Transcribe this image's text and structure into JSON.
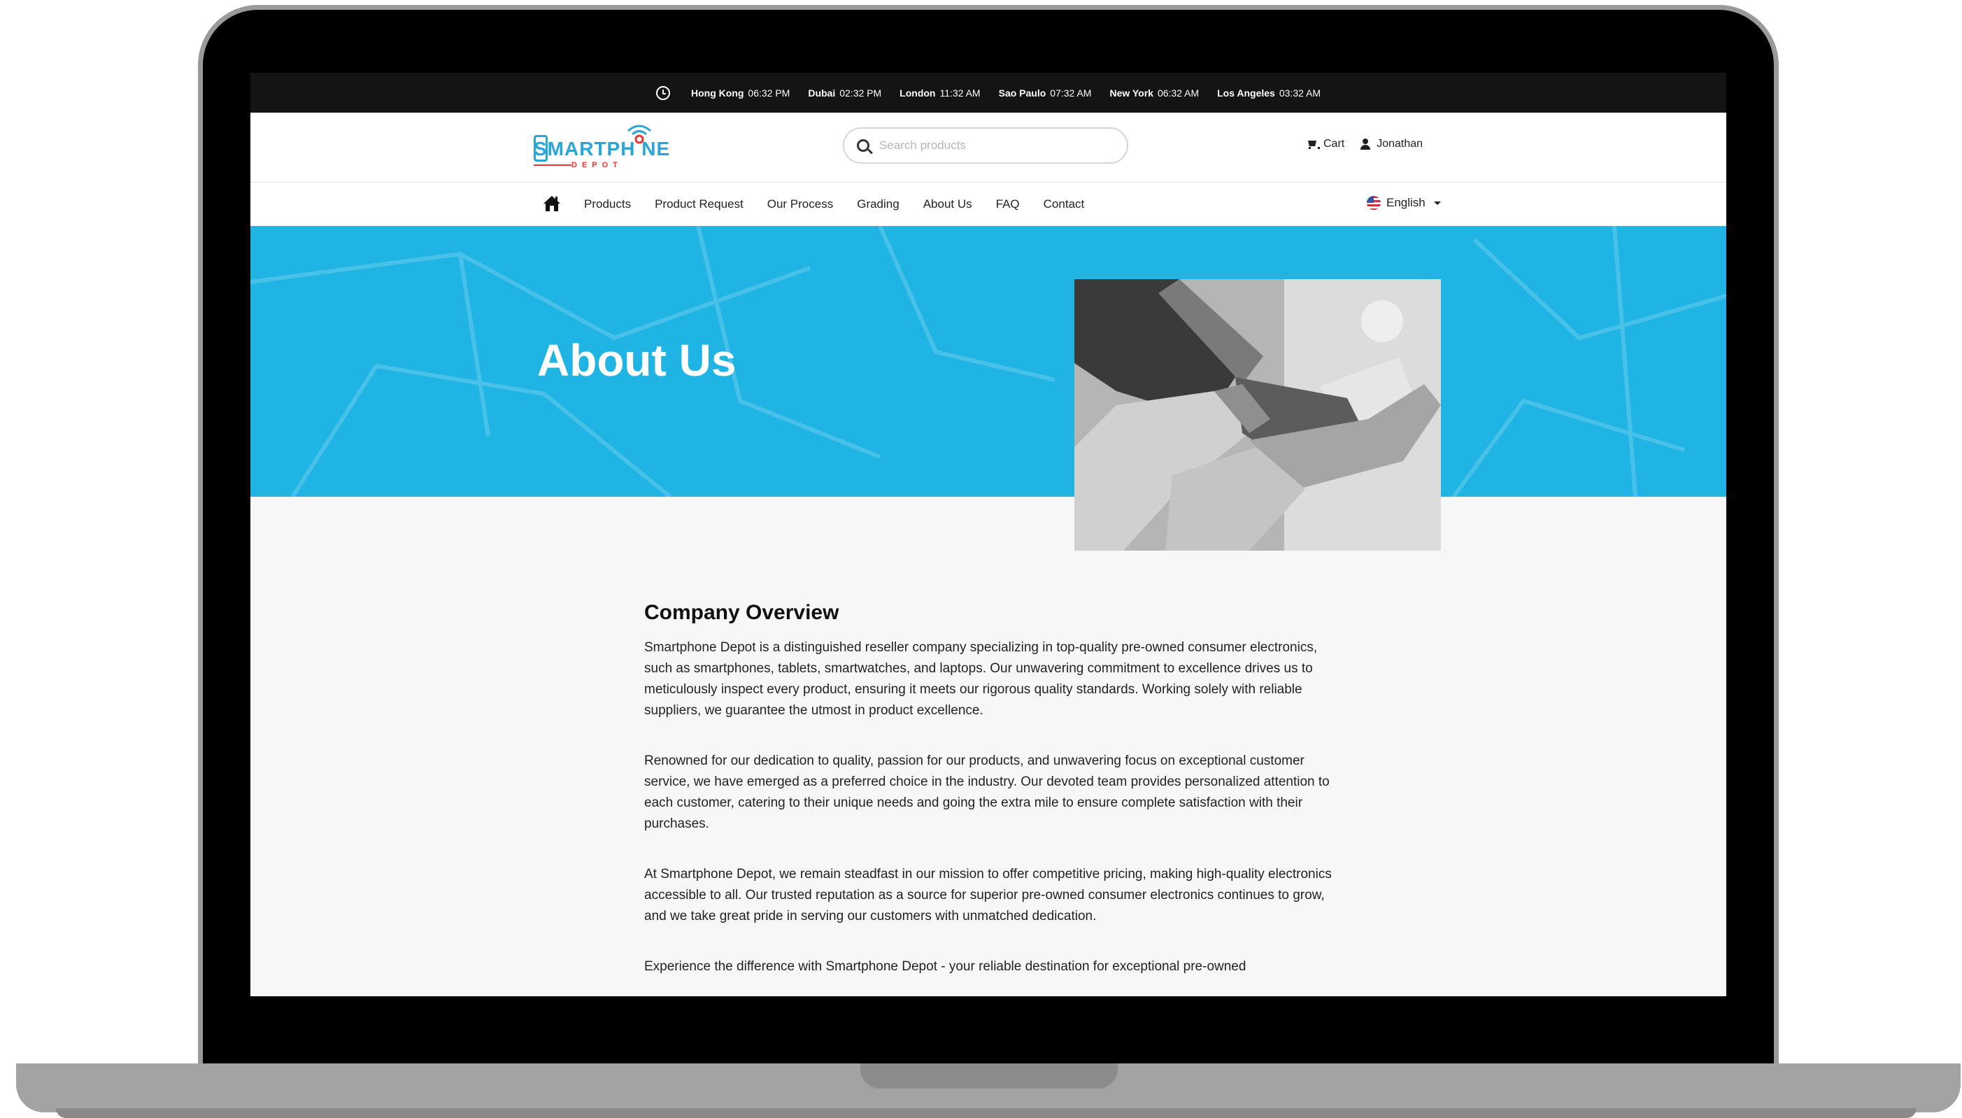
{
  "clocks": [
    {
      "city": "Hong Kong",
      "time": "06:32 PM"
    },
    {
      "city": "Dubai",
      "time": "02:32 PM"
    },
    {
      "city": "London",
      "time": "11:32 AM"
    },
    {
      "city": "Sao Paulo",
      "time": "07:32 AM"
    },
    {
      "city": "New York",
      "time": "06:32 AM"
    },
    {
      "city": "Los Angeles",
      "time": "03:32 AM"
    }
  ],
  "header": {
    "logo_text": "SMARTPH NE",
    "logo_sub": "DEPOT",
    "search_placeholder": "Search products",
    "cart_label": "Cart",
    "user_label": "Jonathan"
  },
  "nav": {
    "links": [
      "Products",
      "Product Request",
      "Our Process",
      "Grading",
      "About Us",
      "FAQ",
      "Contact"
    ],
    "language": "English"
  },
  "hero": {
    "title": "About Us"
  },
  "content": {
    "heading": "Company Overview",
    "paragraphs": [
      "Smartphone Depot is a distinguished reseller company specializing in top-quality pre-owned consumer electronics, such as smartphones, tablets, smartwatches, and laptops. Our unwavering commitment to excellence drives us to meticulously inspect every product, ensuring it meets our rigorous quality standards. Working solely with reliable suppliers, we guarantee the utmost in product excellence.",
      "Renowned for our dedication to quality, passion for our products, and unwavering focus on exceptional customer service, we have emerged as a preferred choice in the industry. Our devoted team provides personalized attention to each customer, catering to their unique needs and going the extra mile to ensure complete satisfaction with their purchases.",
      "At Smartphone Depot, we remain steadfast in our mission to offer competitive pricing, making high-quality electronics accessible to all. Our trusted reputation as a source for superior pre-owned consumer electronics continues to grow, and we take great pride in serving our customers with unmatched dedication.",
      "Experience the difference with Smartphone Depot - your reliable destination for exceptional pre-owned"
    ]
  },
  "colors": {
    "brand_blue": "#1fb4e3",
    "logo_blue": "#2aa5d8",
    "logo_red": "#e8352f",
    "topbar": "#141414"
  }
}
